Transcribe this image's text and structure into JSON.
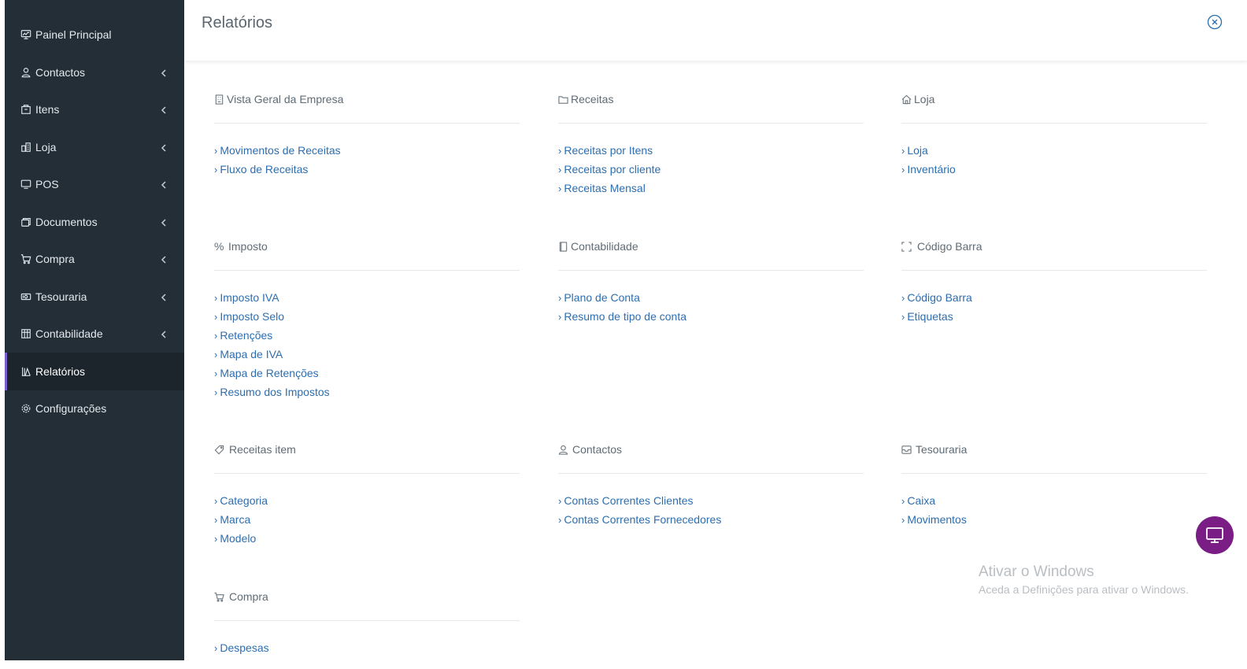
{
  "sidebar": {
    "items": [
      {
        "label": "Painel Principal",
        "icon": "dashboard-icon",
        "has_chevron": false,
        "active": false
      },
      {
        "label": "Contactos",
        "icon": "users-icon",
        "has_chevron": true,
        "active": false
      },
      {
        "label": "Itens",
        "icon": "box-icon",
        "has_chevron": true,
        "active": false
      },
      {
        "label": "Loja",
        "icon": "building-icon",
        "has_chevron": true,
        "active": false
      },
      {
        "label": "POS",
        "icon": "monitor-icon",
        "has_chevron": true,
        "active": false
      },
      {
        "label": "Documentos",
        "icon": "documents-icon",
        "has_chevron": true,
        "active": false
      },
      {
        "label": "Compra",
        "icon": "cart-icon",
        "has_chevron": true,
        "active": false
      },
      {
        "label": "Tesouraria",
        "icon": "money-icon",
        "has_chevron": true,
        "active": false
      },
      {
        "label": "Contabilidade",
        "icon": "ledger-icon",
        "has_chevron": true,
        "active": false
      },
      {
        "label": "Relatórios",
        "icon": "reports-icon",
        "has_chevron": false,
        "active": true
      },
      {
        "label": "Configurações",
        "icon": "settings-icon",
        "has_chevron": false,
        "active": false
      }
    ]
  },
  "header": {
    "title": "Relatórios",
    "close_icon": "close-circle-icon"
  },
  "sections": [
    {
      "id": "vista-geral",
      "title": "Vista Geral da Empresa",
      "icon": "building-icon",
      "links": [
        "Movimentos de Receitas",
        "Fluxo de Receitas"
      ]
    },
    {
      "id": "receitas",
      "title": "Receitas",
      "icon": "folder-icon",
      "links": [
        "Receitas por Itens",
        "Receitas por cliente",
        "Receitas Mensal"
      ]
    },
    {
      "id": "loja",
      "title": "Loja",
      "icon": "home-icon",
      "links": [
        "Loja",
        "Inventário"
      ]
    },
    {
      "id": "imposto",
      "title": "Imposto",
      "icon": "percent-icon",
      "links": [
        "Imposto IVA",
        "Imposto Selo",
        "Retenções",
        "Mapa de IVA",
        "Mapa de Retenções",
        "Resumo dos Impostos"
      ]
    },
    {
      "id": "contabilidade",
      "title": "Contabilidade",
      "icon": "book-icon",
      "links": [
        "Plano de Conta",
        "Resumo de tipo de conta"
      ]
    },
    {
      "id": "codigo-barra",
      "title": "Código Barra",
      "icon": "barcode-icon",
      "links": [
        "Código Barra",
        "Etiquetas"
      ]
    },
    {
      "id": "receitas-item",
      "title": "Receitas item",
      "icon": "tag-icon",
      "links": [
        "Categoria",
        "Marca",
        "Modelo"
      ]
    },
    {
      "id": "contactos",
      "title": "Contactos",
      "icon": "user-icon",
      "links": [
        "Contas Correntes Clientes",
        "Contas Correntes Fornecedores"
      ]
    },
    {
      "id": "tesouraria",
      "title": "Tesouraria",
      "icon": "inbox-icon",
      "links": [
        "Caixa",
        "Movimentos"
      ]
    },
    {
      "id": "compra",
      "title": "Compra",
      "icon": "cart-icon",
      "links": [
        "Despesas"
      ]
    }
  ],
  "watermark": {
    "line1": "Ativar o Windows",
    "line2": "Aceda a Definições para ativar o Windows."
  },
  "fab": {
    "icon": "monitor-icon"
  },
  "colors": {
    "sidebar_bg": "#232e36",
    "active_accent": "#7a5fd3",
    "link": "#2c6eb1",
    "fab": "#7a1e86",
    "close_icon": "#2c6eb1"
  }
}
